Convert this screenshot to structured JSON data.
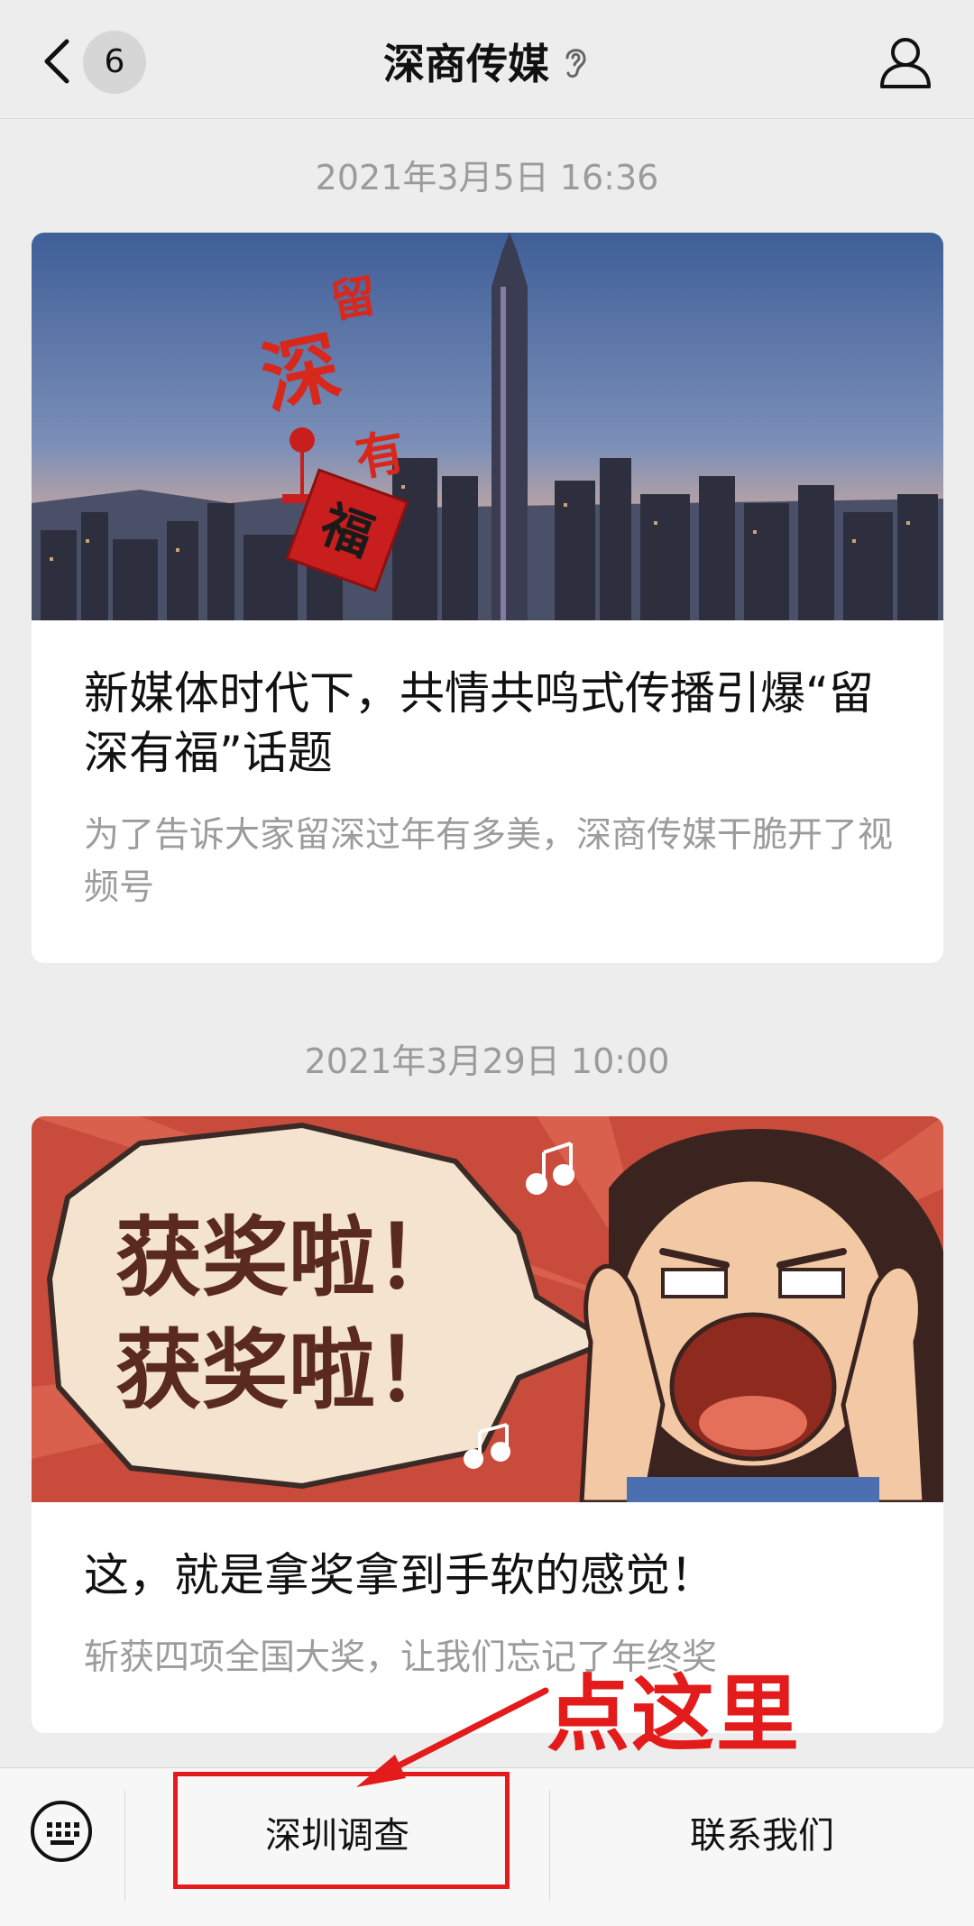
{
  "header": {
    "back_count": "6",
    "title": "深商传媒"
  },
  "feed": [
    {
      "timestamp": "2021年3月5日 16:36",
      "image_text": [
        "留",
        "深",
        "有",
        "福"
      ],
      "title": "新媒体时代下，共情共鸣式传播引爆“留深有福”话题",
      "subtitle": "为了告诉大家留深过年有多美，深商传媒干脆开了视频号"
    },
    {
      "timestamp": "2021年3月29日 10:00",
      "image_text": [
        "获奖啦！",
        "获奖啦！"
      ],
      "title": "这，就是拿奖拿到手软的感觉！",
      "subtitle": "斩获四项全国大奖，让我们忘记了年终奖"
    }
  ],
  "menu": {
    "items": [
      "深圳调查",
      "联系我们"
    ]
  },
  "annotation": {
    "text": "点这里",
    "color": "#e31b1b"
  }
}
